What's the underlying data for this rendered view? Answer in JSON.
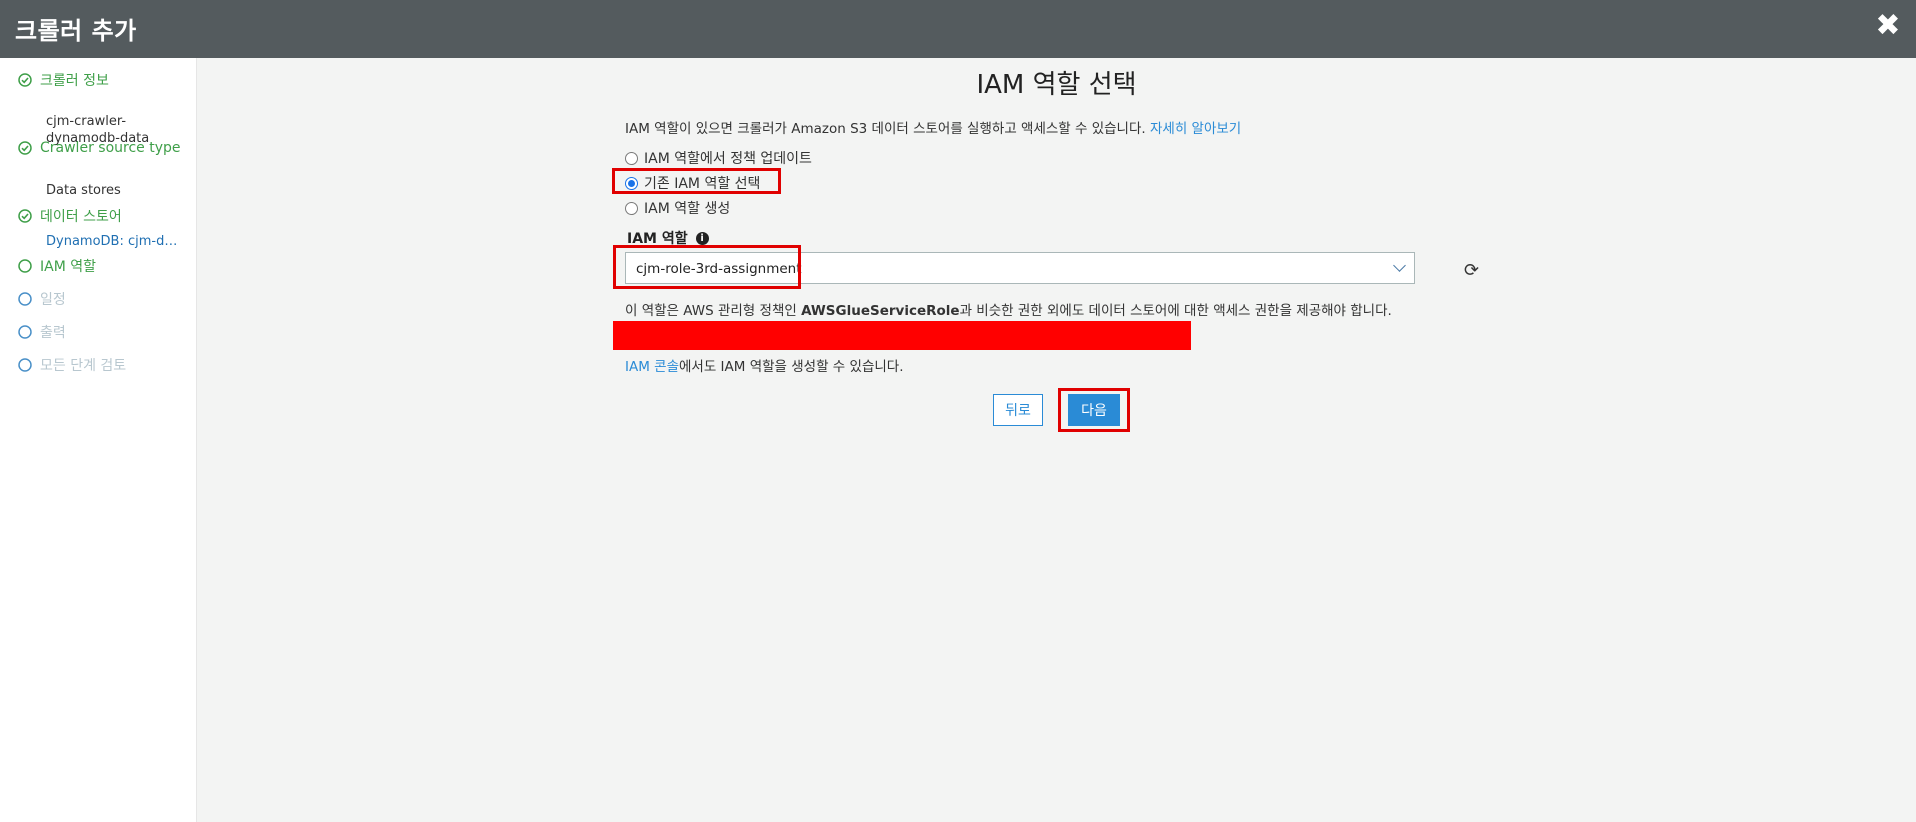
{
  "header": {
    "title": "크롤러 추가",
    "close_icon": "close-icon"
  },
  "sidebar": {
    "steps": [
      {
        "label": "크롤러 정보",
        "state": "done",
        "sub": "cjm-crawler-\ndynamodb-data"
      },
      {
        "label": "Crawler source type",
        "state": "done",
        "sub": "Data stores"
      },
      {
        "label": "데이터 스토어",
        "state": "done",
        "sub": "DynamoDB: cjm-dy..."
      },
      {
        "label": "IAM 역할",
        "state": "active"
      },
      {
        "label": "일정",
        "state": "pending"
      },
      {
        "label": "출력",
        "state": "pending"
      },
      {
        "label": "모든 단계 검토",
        "state": "pending"
      }
    ]
  },
  "main": {
    "title": "IAM 역할 선택",
    "description": "IAM 역할이 있으면 크롤러가 Amazon S3 데이터 스토어를 실행하고 액세스할 수 있습니다.",
    "learn_more": "자세히 알아보기",
    "radio_options": [
      {
        "label": "IAM 역할에서 정책 업데이트",
        "selected": false
      },
      {
        "label": "기존 IAM 역할 선택",
        "selected": true
      },
      {
        "label": "IAM 역할 생성",
        "selected": false
      }
    ],
    "iam_role_label": "IAM 역할",
    "iam_role_value": "cjm-role-3rd-assignment",
    "policy_note_prefix": "이 역할은 AWS 관리형 정책인 ",
    "policy_note_bold": "AWSGlueServiceRole",
    "policy_note_suffix": "과 비슷한 권한 외에도 데이터 스토어에 대한 액세스 권한을 제공해야 합니다.",
    "console_link": "IAM 콘솔",
    "console_note": "에서도 IAM 역할을 생성할 수 있습니다.",
    "back_label": "뒤로",
    "next_label": "다음"
  },
  "colors": {
    "topbar": "#545b5e",
    "done": "#3f9f49",
    "pending": "#b8c7cf",
    "link": "#2a8bd6",
    "primary": "#2a8bd6",
    "highlight": "#e00000"
  }
}
